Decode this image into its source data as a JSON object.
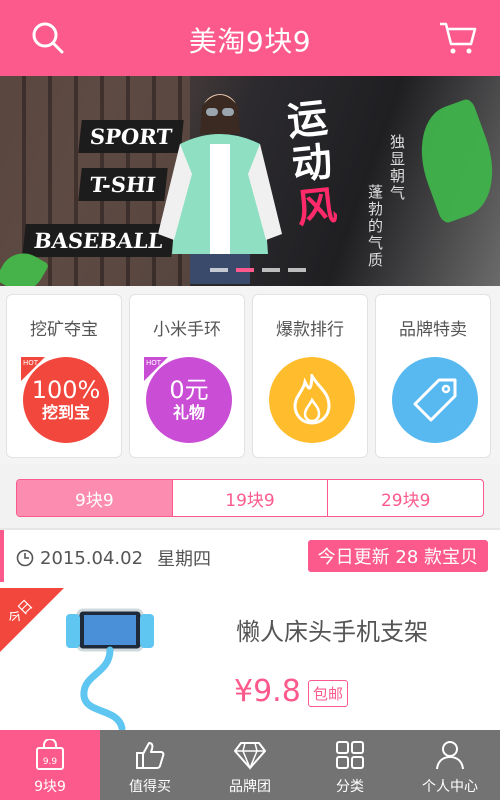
{
  "header": {
    "title": "美淘9块9",
    "search_icon": "search-icon",
    "cart_icon": "cart-icon",
    "bg_color": "#fc5a8d"
  },
  "banner": {
    "signs": [
      "SPORT",
      "T-SHI",
      "BASEBALL"
    ],
    "headline": [
      "运",
      "动",
      "风"
    ],
    "slogan_line1": "独显朝气",
    "slogan_line2": "蓬勃的气质",
    "dots": 4,
    "active_dot": 1
  },
  "features": [
    {
      "label": "挖矿夺宝",
      "line1": "100%",
      "line2": "挖到宝",
      "color": "#f2473c",
      "hot": "HOT"
    },
    {
      "label": "小米手环",
      "line1": "0元",
      "line2": "礼物",
      "color": "#c94ed5",
      "hot": "HOT"
    },
    {
      "label": "爆款排行",
      "icon": "fire-icon",
      "color": "#ffbd2e"
    },
    {
      "label": "品牌特卖",
      "icon": "tag-icon",
      "color": "#58b9f0"
    }
  ],
  "tabs": [
    {
      "label": "9块9",
      "active": true
    },
    {
      "label": "19块9",
      "active": false
    },
    {
      "label": "29块9",
      "active": false
    }
  ],
  "datebar": {
    "date": "2015.04.02",
    "weekday": "星期四",
    "update_text": "今日更新 28 款宝贝"
  },
  "product": {
    "ribbon": "今日",
    "name": "懒人床头手机支架",
    "price": "¥9.8",
    "badge": "包邮"
  },
  "bottom_nav": [
    {
      "label": "9块9",
      "icon": "bag-icon",
      "icon_text": "9.9",
      "active": true
    },
    {
      "label": "值得买",
      "icon": "thumbs-up-icon",
      "active": false
    },
    {
      "label": "品牌团",
      "icon": "diamond-icon",
      "active": false
    },
    {
      "label": "分类",
      "icon": "grid-icon",
      "active": false
    },
    {
      "label": "个人中心",
      "icon": "person-icon",
      "active": false
    }
  ]
}
